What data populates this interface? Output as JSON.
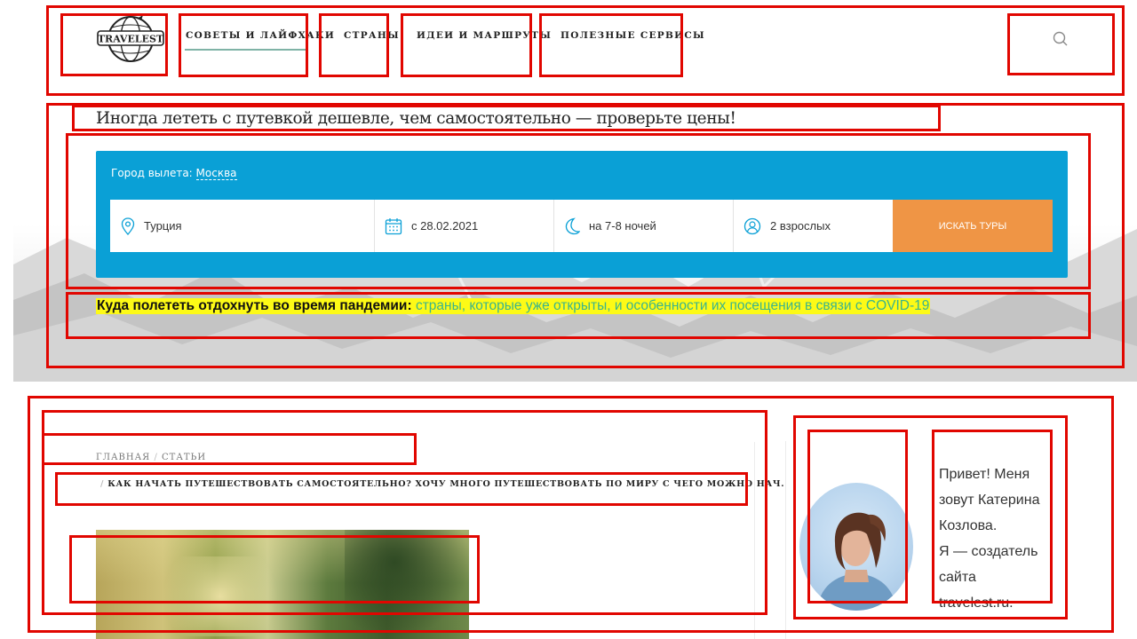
{
  "header": {
    "logo_text": "TRAVELEST",
    "nav": [
      {
        "label": "Советы и лайфхаки"
      },
      {
        "label": "Страны"
      },
      {
        "label": "Идеи и маршруты"
      },
      {
        "label": "Полезные сервисы"
      }
    ]
  },
  "hero": {
    "title": "Иногда лететь с путевкой дешевле, чем самостоятельно — проверьте цены!",
    "form": {
      "city_label": "Город вылета:",
      "city_value": "Москва",
      "destination": "Турция",
      "date": "с 28.02.2021",
      "nights": "на 7-8 ночей",
      "guests": "2 взрослых",
      "search_button": "Искать туры"
    },
    "covid": {
      "bold": "Куда полететь отдохнуть во время пандемии",
      "colon": ":",
      "link": "страны, которые уже открыты, и особенности их посещения в связи с COVID-19"
    },
    "colors": {
      "form_bg": "#0aa0d6",
      "button_bg": "#ef9545",
      "highlight": "#fdfa16",
      "link": "#3bb48c"
    }
  },
  "breadcrumb": {
    "home": "Главная",
    "separator": "/",
    "section": "Статьи",
    "current": "Как начать путешествовать самостоятельно? Хочу много путешествовать по миру с чего можно нач..."
  },
  "sidebar": {
    "bio_lines": [
      "Привет! Меня",
      "зовут Катерина",
      "Козлова.",
      "Я — создатель",
      "сайта",
      "travelest.ru."
    ]
  }
}
